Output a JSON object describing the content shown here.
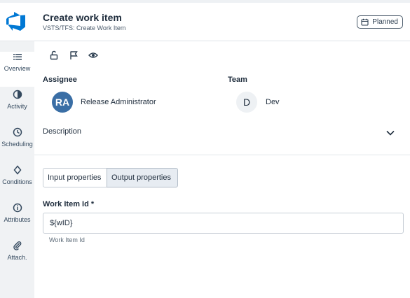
{
  "header": {
    "title": "Create work item",
    "subtitle": "VSTS/TFS: Create Work Item",
    "status_badge": "Planned"
  },
  "sidebar": {
    "items": [
      {
        "label": "Overview",
        "icon": "list-icon"
      },
      {
        "label": "Activity",
        "icon": "pie-chart-icon"
      },
      {
        "label": "Scheduling",
        "icon": "clock-icon"
      },
      {
        "label": "Conditions",
        "icon": "diamond-icon"
      },
      {
        "label": "Attributes",
        "icon": "info-icon"
      },
      {
        "label": "Attach.",
        "icon": "paperclip-icon"
      }
    ]
  },
  "toolbar": {
    "icons": [
      "unlock-icon",
      "flag-icon",
      "eye-icon"
    ]
  },
  "assignee": {
    "label": "Assignee",
    "initials": "RA",
    "name": "Release Administrator"
  },
  "team": {
    "label": "Team",
    "initials": "D",
    "name": "Dev"
  },
  "description": {
    "label": "Description"
  },
  "tabs": [
    {
      "label": "Input properties"
    },
    {
      "label": "Output properties"
    }
  ],
  "field": {
    "label": "Work Item Id *",
    "value": "${wID}",
    "help": "Work Item Id"
  },
  "colors": {
    "brand": "#0078d4",
    "avatar": "#3a6ea5"
  }
}
